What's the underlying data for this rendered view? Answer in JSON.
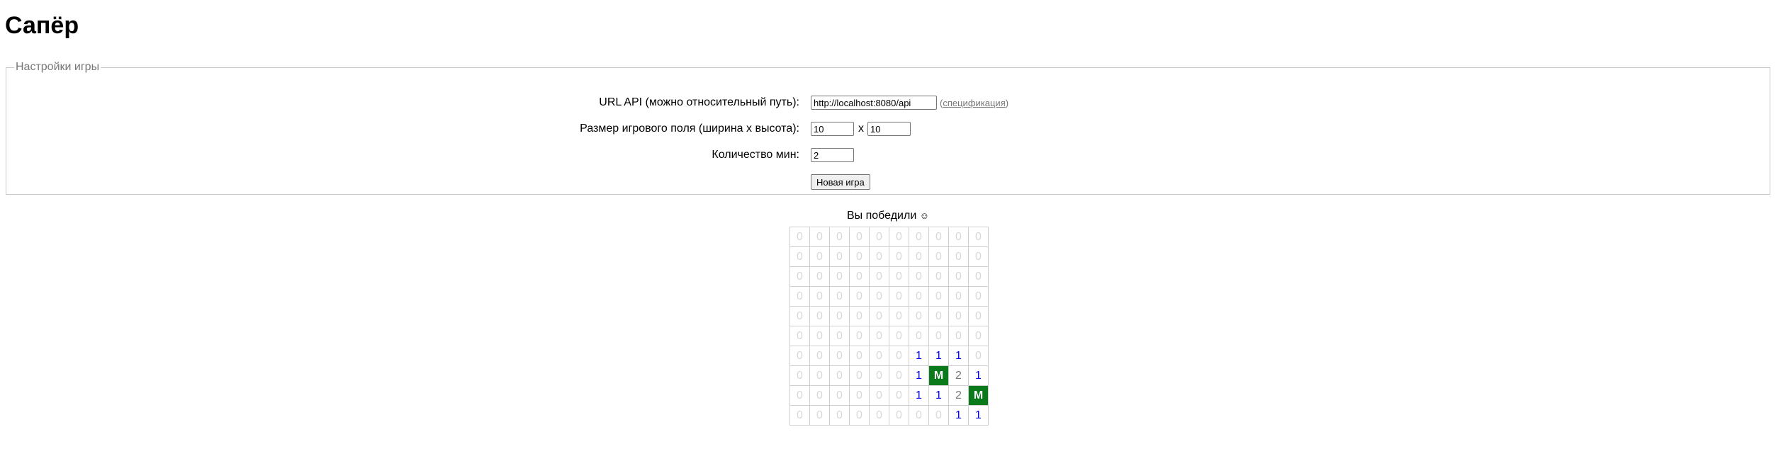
{
  "page_title": "Сапёр",
  "settings": {
    "legend": "Настройки игры",
    "api_url_label": "URL API (можно относительный путь):",
    "api_url_value": "http://localhost:8080/api",
    "spec_open": "(",
    "spec_link": "спецификация",
    "spec_close": ")",
    "size_label": "Размер игрового поля (ширина x высота):",
    "width_value": "10",
    "size_separator": "x",
    "height_value": "10",
    "mines_label": "Количество мин:",
    "mines_value": "2",
    "new_game_label": "Новая игра"
  },
  "status": {
    "text": "Вы победили",
    "emoticon": "☺"
  },
  "board": {
    "rows": [
      [
        "0",
        "0",
        "0",
        "0",
        "0",
        "0",
        "0",
        "0",
        "0",
        "0"
      ],
      [
        "0",
        "0",
        "0",
        "0",
        "0",
        "0",
        "0",
        "0",
        "0",
        "0"
      ],
      [
        "0",
        "0",
        "0",
        "0",
        "0",
        "0",
        "0",
        "0",
        "0",
        "0"
      ],
      [
        "0",
        "0",
        "0",
        "0",
        "0",
        "0",
        "0",
        "0",
        "0",
        "0"
      ],
      [
        "0",
        "0",
        "0",
        "0",
        "0",
        "0",
        "0",
        "0",
        "0",
        "0"
      ],
      [
        "0",
        "0",
        "0",
        "0",
        "0",
        "0",
        "0",
        "0",
        "0",
        "0"
      ],
      [
        "0",
        "0",
        "0",
        "0",
        "0",
        "0",
        "1",
        "1",
        "1",
        "0"
      ],
      [
        "0",
        "0",
        "0",
        "0",
        "0",
        "0",
        "1",
        "M",
        "2",
        "1"
      ],
      [
        "0",
        "0",
        "0",
        "0",
        "0",
        "0",
        "1",
        "1",
        "2",
        "M"
      ],
      [
        "0",
        "0",
        "0",
        "0",
        "0",
        "0",
        "0",
        "0",
        "1",
        "1"
      ]
    ]
  },
  "colors": {
    "mine_cell": "#0a7a1a",
    "one": "#0000ee",
    "two": "#777777",
    "zero": "#d8d8d8"
  }
}
